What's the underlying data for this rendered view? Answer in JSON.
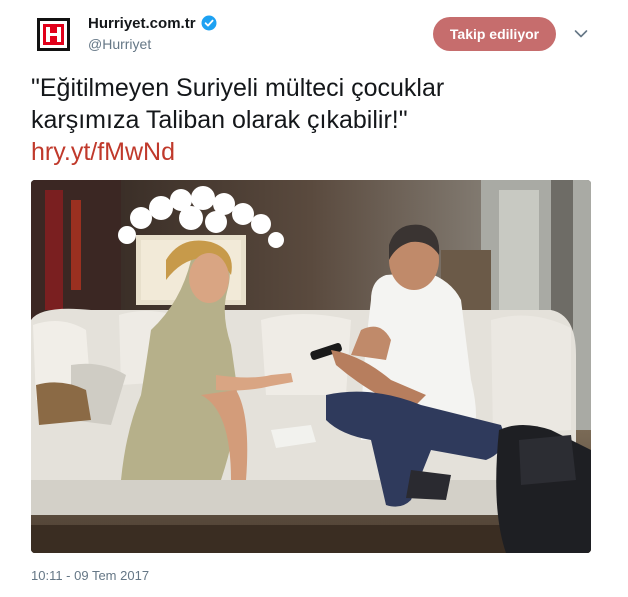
{
  "account": {
    "name": "Hurriyet.com.tr",
    "handle": "@Hurriyet",
    "verified": true,
    "avatar_letter": "H"
  },
  "follow_button": {
    "label": "Takip ediliyor",
    "color": "#c66d6d"
  },
  "menu_icon": "chevron-down-icon",
  "tweet": {
    "text_line1": "\"Eğitilmeyen Suriyeli mülteci çocuklar",
    "text_line2": "karşımıza Taliban olarak çıkabilir!\"",
    "link": "hry.yt/fMwNd",
    "link_color": "#c0392b"
  },
  "media": {
    "type": "photo",
    "description_icon": "interview-photo"
  },
  "timestamp": "10:11 - 09 Tem 2017",
  "colors": {
    "text": "#14171a",
    "secondary": "#657786",
    "verified": "#1da1f2",
    "logo_red": "#e1001a"
  }
}
